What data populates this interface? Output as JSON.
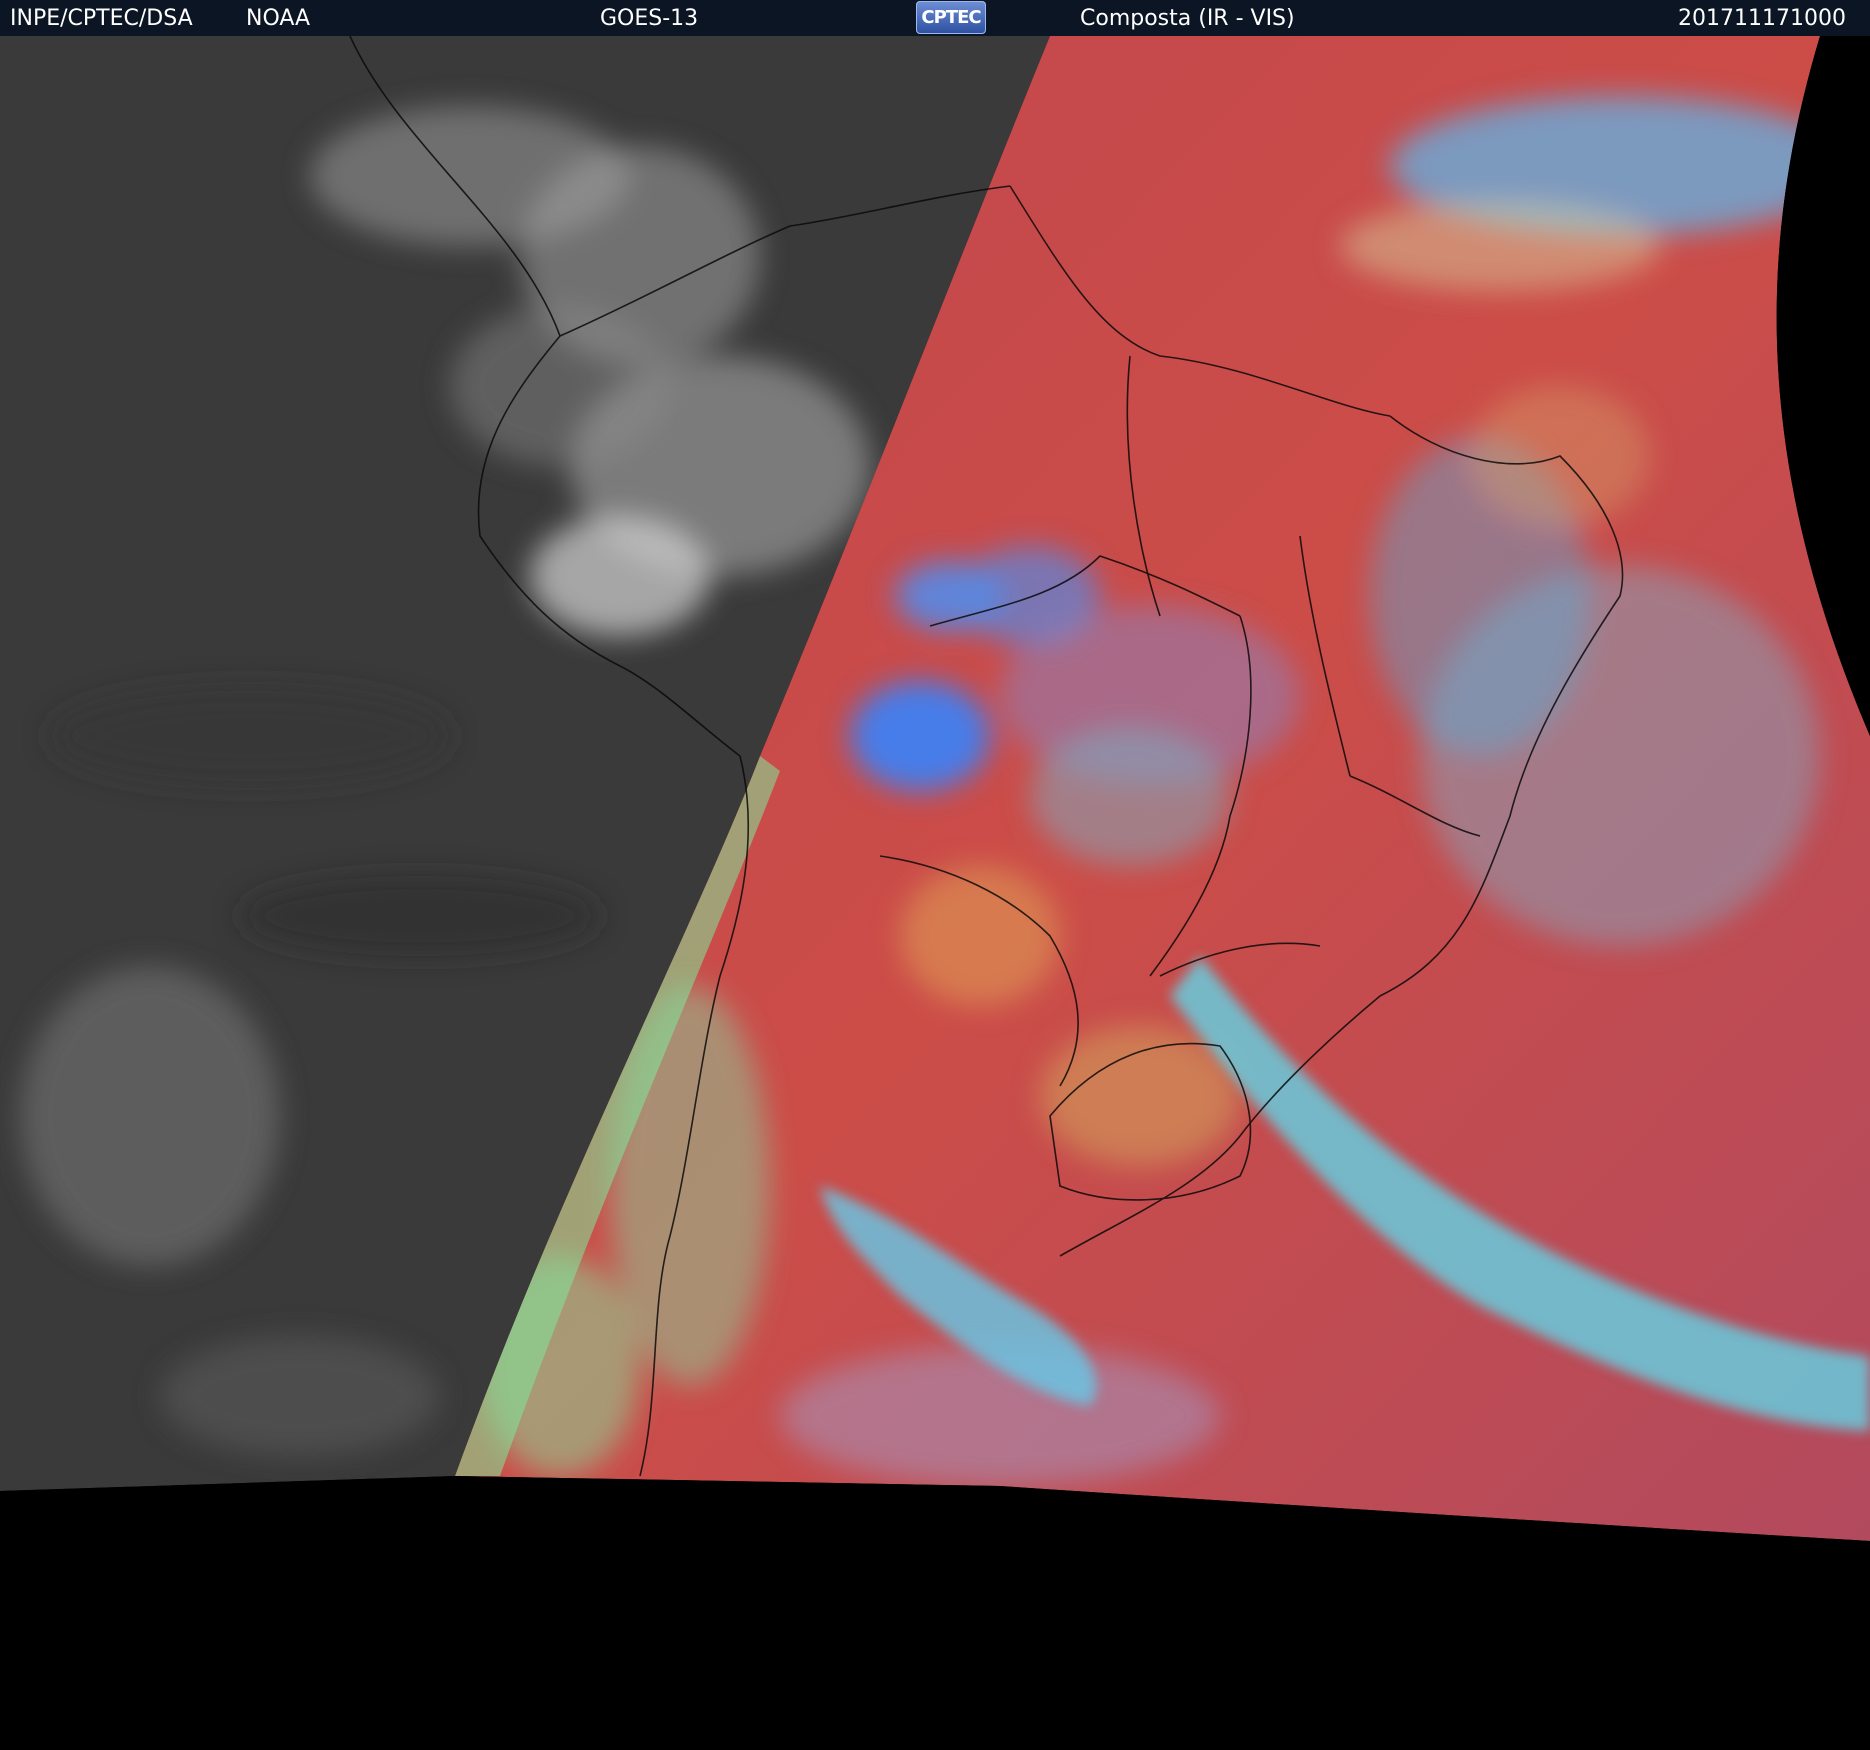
{
  "header": {
    "organization": "INPE/CPTEC/DSA",
    "agency": "NOAA",
    "satellite": "GOES-13",
    "logo_text": "CPTEC",
    "product": "Composta (IR - VIS)",
    "timestamp": "201711171000"
  },
  "colors": {
    "header_background": "#0b1524",
    "night_infrared": "#3c3c3c",
    "day_composite_land": "#c84a4a",
    "day_composite_cloud": "#59b9e8",
    "terminator_edge": "#7fe89a",
    "outside_disk": "#000000"
  },
  "icons": [
    "cptec-logo-icon"
  ]
}
